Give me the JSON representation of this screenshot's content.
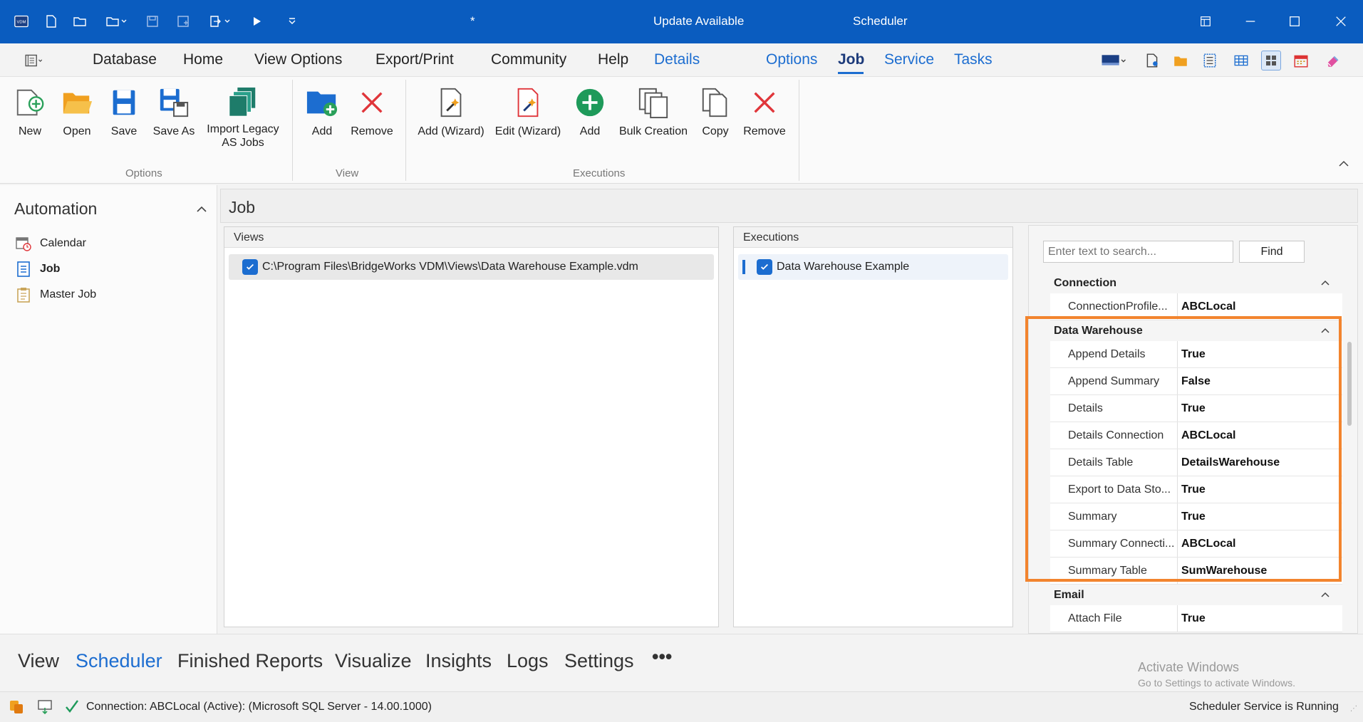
{
  "titlebar": {
    "modified_marker": "*",
    "update": "Update Available",
    "title": "Scheduler"
  },
  "menu": {
    "items": [
      "Database",
      "Home",
      "View Options",
      "Export/Print",
      "Community",
      "Help",
      "Details"
    ],
    "context_tabs": [
      "Options",
      "Job",
      "Service",
      "Tasks"
    ]
  },
  "ribbon": {
    "options": {
      "label": "Options",
      "buttons": [
        "New",
        "Open",
        "Save",
        "Save As",
        "Import Legacy",
        "AS Jobs"
      ]
    },
    "view": {
      "label": "View",
      "buttons": [
        "Add",
        "Remove"
      ]
    },
    "executions": {
      "label": "Executions",
      "buttons": [
        "Add (Wizard)",
        "Edit (Wizard)",
        "Add",
        "Bulk Creation",
        "Copy",
        "Remove"
      ]
    }
  },
  "left": {
    "title": "Automation",
    "items": [
      "Calendar",
      "Job",
      "Master Job"
    ]
  },
  "job_header": "Job",
  "views": {
    "title": "Views",
    "rows": [
      "C:\\Program Files\\BridgeWorks VDM\\Views\\Data Warehouse Example.vdm"
    ]
  },
  "executions": {
    "title": "Executions",
    "rows": [
      "Data Warehouse Example"
    ]
  },
  "propgrid": {
    "search_placeholder": "Enter text to search...",
    "find": "Find",
    "categories": [
      {
        "name": "Connection",
        "rows": [
          {
            "name": "ConnectionProfile...",
            "value": "ABCLocal"
          }
        ]
      },
      {
        "name": "Data Warehouse",
        "rows": [
          {
            "name": "Append Details",
            "value": "True"
          },
          {
            "name": "Append Summary",
            "value": "False"
          },
          {
            "name": "Details",
            "value": "True"
          },
          {
            "name": "Details Connection",
            "value": "ABCLocal"
          },
          {
            "name": "Details Table",
            "value": "DetailsWarehouse"
          },
          {
            "name": "Export to Data Sto...",
            "value": "True"
          },
          {
            "name": "Summary",
            "value": "True"
          },
          {
            "name": "Summary Connecti...",
            "value": "ABCLocal"
          },
          {
            "name": "Summary Table",
            "value": "SumWarehouse"
          }
        ]
      },
      {
        "name": "Email",
        "rows": [
          {
            "name": "Attach File",
            "value": "True"
          }
        ]
      }
    ]
  },
  "bottom_nav": [
    "View",
    "Scheduler",
    "Finished Reports",
    "Visualize",
    "Insights",
    "Logs",
    "Settings",
    "•••"
  ],
  "watermark": {
    "line1": "Activate Windows",
    "line2": "Go to Settings to activate Windows."
  },
  "status": {
    "connection": "Connection: ABCLocal (Active): (Microsoft SQL Server - 14.00.1000)",
    "service": "Scheduler Service is Running"
  },
  "colors": {
    "titlebar": "#0a5cbf",
    "accent": "#1c6dd0",
    "highlight": "#f2842e"
  }
}
